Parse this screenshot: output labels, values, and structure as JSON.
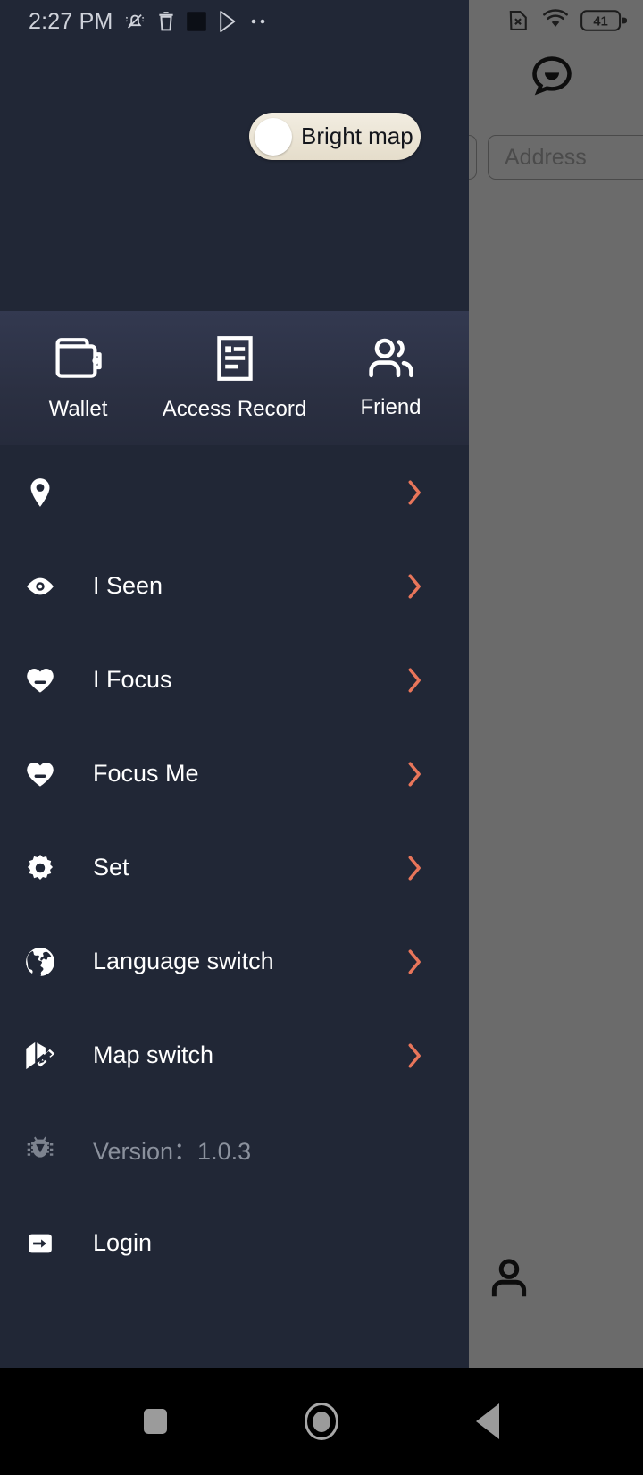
{
  "status_bar": {
    "time": "2:27 PM",
    "left_icons": [
      "mute-icon",
      "trash-icon",
      "square-app-icon",
      "play-store-icon",
      "more-dots-icon"
    ],
    "right_icons": [
      "no-sim-icon",
      "wifi-icon"
    ],
    "battery_level": "41"
  },
  "toggle": {
    "label": "Bright map",
    "state": "off",
    "track_color": "#ece6d8",
    "knob_color": "#ffffff"
  },
  "quick_actions": [
    {
      "label": "Wallet",
      "icon": "wallet-icon"
    },
    {
      "label": "Access Record",
      "icon": "document-record-icon"
    },
    {
      "label": "Friend",
      "icon": "people-icon"
    }
  ],
  "menu_items": [
    {
      "label": "",
      "icon": "location-pin-icon",
      "chevron": true
    },
    {
      "label": "I Seen",
      "icon": "eye-icon",
      "chevron": true
    },
    {
      "label": "I Focus",
      "icon": "heart-icon",
      "chevron": true
    },
    {
      "label": "Focus Me",
      "icon": "heart-icon",
      "chevron": true
    },
    {
      "label": "Set",
      "icon": "gear-icon",
      "chevron": true
    },
    {
      "label": "Language switch",
      "icon": "globe-icon",
      "chevron": true
    },
    {
      "label": "Map switch",
      "icon": "map-edit-icon",
      "chevron": true
    }
  ],
  "version_row": {
    "label": "Version：1.0.3",
    "icon": "bug-icon"
  },
  "login_row": {
    "label": "Login",
    "icon": "login-arrow-icon"
  },
  "background_app": {
    "address_placeholder": "Address",
    "chat_icon": "chat-bubble-icon",
    "profile_icon": "person-icon"
  },
  "nav_bar": {
    "recents": "recents-square-icon",
    "home": "home-circle-icon",
    "back": "back-triangle-icon"
  },
  "colors": {
    "drawer_bg": "#212736",
    "quick_band": "#2e3446",
    "accent_chevron": "#e8755a",
    "text_primary": "#ffffff",
    "text_muted": "#8b919d",
    "scrim": "#6b6b6b"
  }
}
